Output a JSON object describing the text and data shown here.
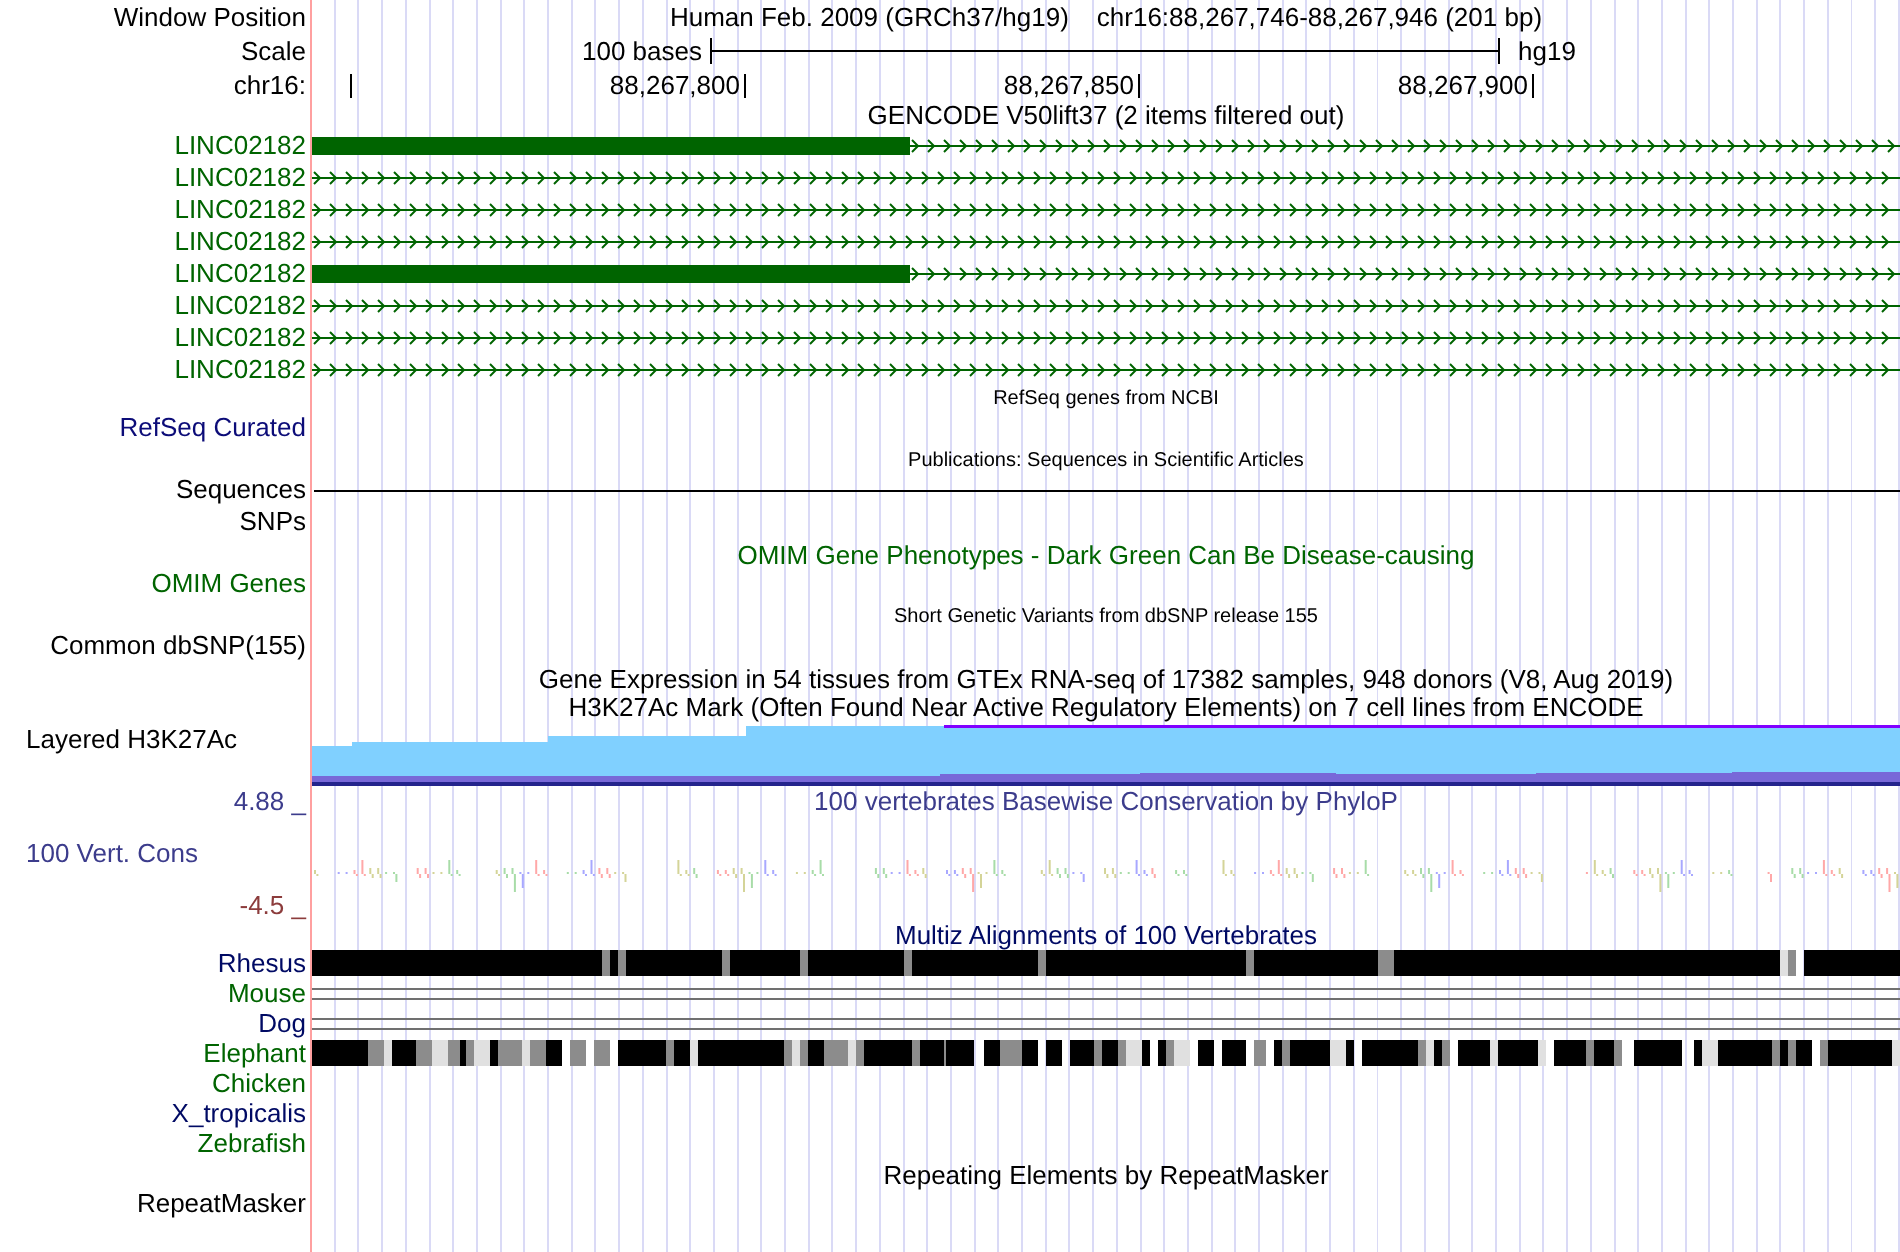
{
  "header": {
    "window_position": {
      "label": "Window Position",
      "assembly": "Human Feb. 2009 (GRCh37/hg19)",
      "range": "chr16:88,267,746-88,267,946 (201 bp)"
    },
    "scale": {
      "label": "Scale",
      "length": "100 bases",
      "assembly": "hg19"
    },
    "ruler": {
      "label": "chr16:",
      "ticks": [
        "88,267,800",
        "88,267,850",
        "88,267,900"
      ]
    }
  },
  "tracks": [
    {
      "kind": "full",
      "title": "GENCODE V50lift37 (2 items filtered out)",
      "color": "#000000",
      "rows": [
        {
          "kind": "exon",
          "label": "LINC02182",
          "color": "#006400"
        },
        {
          "kind": "intron",
          "label": "LINC02182",
          "color": "#006400"
        },
        {
          "kind": "intron",
          "label": "LINC02182",
          "color": "#006400"
        },
        {
          "kind": "intron",
          "label": "LINC02182",
          "color": "#006400"
        },
        {
          "kind": "exon",
          "label": "LINC02182",
          "color": "#006400"
        },
        {
          "kind": "intron",
          "label": "LINC02182",
          "color": "#006400"
        },
        {
          "kind": "intron",
          "label": "LINC02182",
          "color": "#006400"
        },
        {
          "kind": "intron",
          "label": "LINC02182",
          "color": "#006400"
        }
      ]
    },
    {
      "kind": "dense",
      "title": "RefSeq genes from NCBI",
      "color": "#000000",
      "rows": [
        {
          "kind": "empty",
          "label": "RefSeq Curated",
          "color": "#0c0c78"
        }
      ]
    },
    {
      "kind": "dense",
      "title": "Publications: Sequences in Scientific Articles",
      "color": "#000000",
      "rows": [
        {
          "kind": "line",
          "label": "Sequences",
          "color": "#000000"
        },
        {
          "kind": "empty",
          "label": "SNPs",
          "color": "#000000"
        }
      ]
    },
    {
      "kind": "full",
      "title": "OMIM Gene Phenotypes - Dark Green Can Be Disease-causing",
      "color": "#006400",
      "rows": [
        {
          "kind": "empty",
          "label": "OMIM Genes",
          "color": "#006400"
        }
      ]
    },
    {
      "kind": "dense",
      "title": "Short Genetic Variants from dbSNP release 155",
      "color": "#000000",
      "rows": [
        {
          "kind": "empty",
          "label": "Common dbSNP(155)",
          "color": "#000000"
        }
      ]
    },
    {
      "kind": "full",
      "title": "Gene Expression in 54 tissues from GTEx RNA-seq of 17382 samples, 948 donors (V8, Aug 2019)",
      "color": "#000000"
    },
    {
      "kind": "full",
      "title": "H3K27Ac Mark (Often Found Near Active Regulatory Elements) on 7 cell lines from ENCODE",
      "color": "#000000",
      "rows": [
        {
          "kind": "signal",
          "label": "Layered H3K27Ac",
          "color": "#000000"
        }
      ]
    },
    {
      "kind": "full",
      "title": "100 vertebrates Basewise Conservation by PhyloP",
      "color": "#3c3c8c",
      "axis_max": "4.88 _",
      "rows": [
        {
          "kind": "wiggle",
          "label": "100 Vert. Cons",
          "color": "#3c3c8c",
          "axis_min": "-4.5 _"
        }
      ]
    },
    {
      "kind": "alignment",
      "title": "Multiz Alignments of 100 Vertebrates",
      "color": "#000a64",
      "rows": [
        {
          "kind": "solid",
          "label": "Rhesus",
          "color": "#000a64"
        },
        {
          "kind": "lines",
          "label": "Mouse",
          "color": "#006400"
        },
        {
          "kind": "lines",
          "label": "Dog",
          "color": "#000a64"
        },
        {
          "kind": "mottled",
          "label": "Elephant",
          "color": "#006400"
        },
        {
          "kind": "empty",
          "label": "Chicken",
          "color": "#006400"
        },
        {
          "kind": "empty",
          "label": "X_tropicalis",
          "color": "#000a64"
        },
        {
          "kind": "empty",
          "label": "Zebrafish",
          "color": "#006400"
        }
      ]
    },
    {
      "kind": "full",
      "title": "Repeating Elements by RepeatMasker",
      "color": "#000000",
      "rows": [
        {
          "kind": "empty",
          "label": "RepeatMasker",
          "color": "#000000"
        }
      ]
    }
  ]
}
